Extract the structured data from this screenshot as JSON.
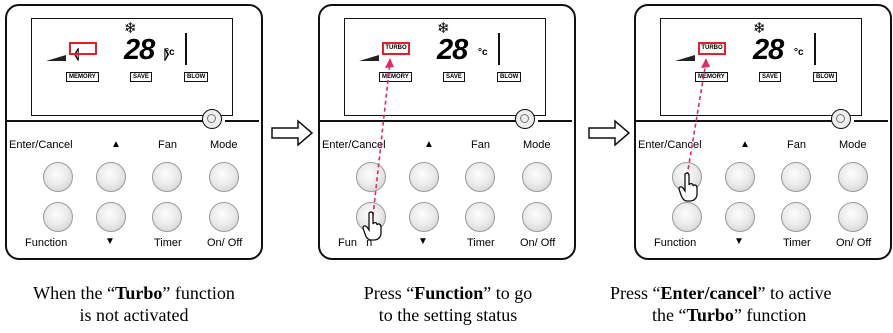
{
  "panels": [
    {
      "lcd": {
        "temp": "28",
        "unit": "°c",
        "fan_icon": "snowflake-icon",
        "turbo_label": "",
        "indicators": [
          "MEMORY",
          "SAVE",
          "BLOW"
        ]
      },
      "buttons": {
        "enter_cancel": "Enter/Cancel",
        "fan": "Fan",
        "mode": "Mode",
        "function": "Function",
        "timer": "Timer",
        "on_off": "On/ Off",
        "up": "▲",
        "down": "▼"
      },
      "caption": {
        "pre": "When the “",
        "bold": "Turbo",
        "post": "” function",
        "line2": "is not activated"
      }
    },
    {
      "lcd": {
        "temp": "28",
        "unit": "°c",
        "fan_icon": "snowflake-icon",
        "turbo_label": "TURBO",
        "indicators": [
          "MEMORY",
          "SAVE",
          "BLOW"
        ]
      },
      "buttons": {
        "enter_cancel": "Enter/Cancel",
        "fan": "Fan",
        "mode": "Mode",
        "function": "Fun   n",
        "timer": "Timer",
        "on_off": "On/ Off",
        "up": "▲",
        "down": "▼"
      },
      "caption": {
        "pre": "Press “",
        "bold": "Function",
        "post": "” to go",
        "line2": "to the setting status"
      }
    },
    {
      "lcd": {
        "temp": "28",
        "unit": "°c",
        "fan_icon": "snowflake-icon",
        "turbo_label": "TURBO",
        "indicators": [
          "MEMORY",
          "SAVE",
          "BLOW"
        ]
      },
      "buttons": {
        "enter_cancel": "Enter/Cancel",
        "fan": "Fan",
        "mode": "Mode",
        "function": "Function",
        "timer": "Timer",
        "on_off": "On/ Off",
        "up": "▲",
        "down": "▼"
      },
      "caption": {
        "pre": "Press “",
        "bold": "Enter/cancel",
        "post": "” to active",
        "line2_pre": "the “",
        "line2_bold": "Turbo",
        "line2_post": "” function"
      }
    }
  ],
  "colors": {
    "highlight": "#e0212b",
    "dashed_arrow": "#e0286e"
  },
  "icons": {
    "flow_arrow": "right-arrow-icon",
    "hand": "pointing-hand-icon"
  }
}
